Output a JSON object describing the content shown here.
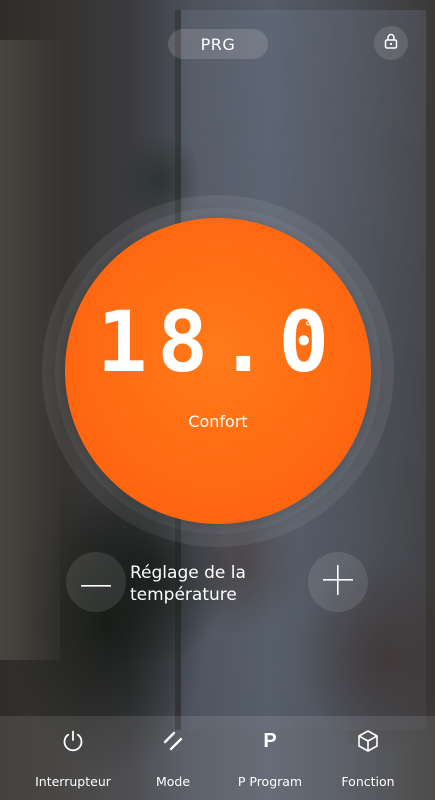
{
  "header": {
    "program_label": "PRG",
    "lock_icon": "lock-icon"
  },
  "thermostat": {
    "temperature": "18.0",
    "unit": "℃",
    "mode": "Confort",
    "dial_color": "#ff6a12"
  },
  "adjust": {
    "label": "Réglage de la température",
    "decrease_icon": "minus-icon",
    "increase_icon": "plus-icon"
  },
  "bottom_nav": {
    "items": [
      {
        "label": "Interrupteur",
        "icon": "power-icon"
      },
      {
        "label": "Mode",
        "icon": "mode-slashes-icon"
      },
      {
        "label": "P Program",
        "icon": "p-letter-icon",
        "glyph": "P"
      },
      {
        "label": "Fonction",
        "icon": "cube-icon"
      }
    ]
  }
}
